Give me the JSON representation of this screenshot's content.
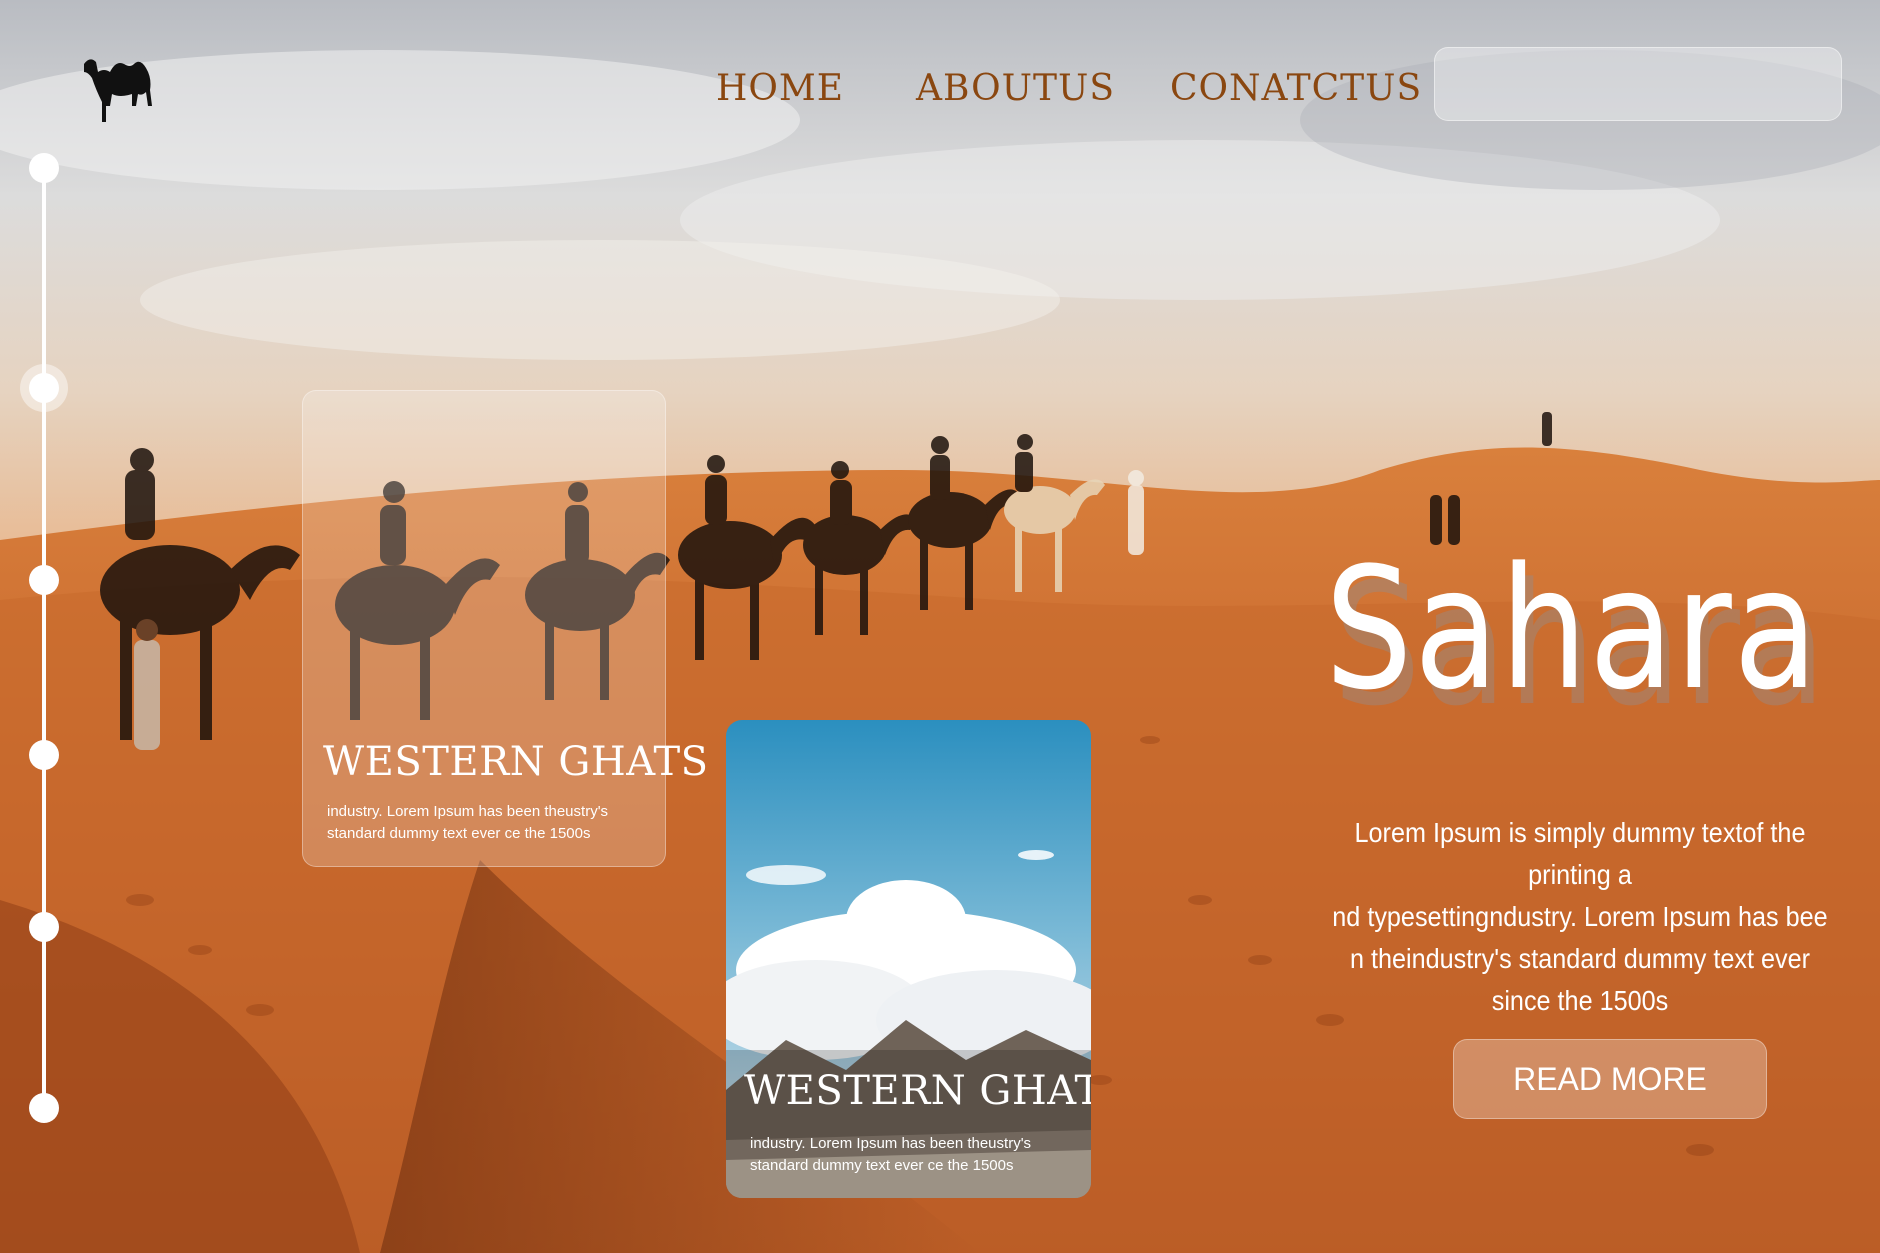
{
  "nav": {
    "items": [
      {
        "label": "HOME"
      },
      {
        "label": "ABOUTUS"
      },
      {
        "label": "CONATCTUS"
      }
    ],
    "search_placeholder": ""
  },
  "tracker": {
    "count": 6,
    "active_index": 1
  },
  "cards": [
    {
      "title": "WESTERN GHATS",
      "text_line1": "industry. Lorem Ipsum has been theustry's",
      "text_line2": "standard dummy text ever ce the 1500s"
    },
    {
      "title": "WESTERN GHATS",
      "text_line1": "industry. Lorem Ipsum has been theustry's",
      "text_line2": "standard dummy text ever ce the 1500s"
    }
  ],
  "hero": {
    "title": "Sahara",
    "desc_line1": "Lorem Ipsum is simply dummy textof the printing a",
    "desc_line2": "nd typesettingndustry. Lorem Ipsum has bee",
    "desc_line3": "n theindustry's standard dummy text ever",
    "desc_line4": "since the 1500s",
    "button_label": "READ MORE"
  },
  "colors": {
    "nav_text": "#8a4710",
    "sand": "#c8682a",
    "sky": "#c9cdd3"
  },
  "icons": {
    "logo": "camel-icon"
  }
}
